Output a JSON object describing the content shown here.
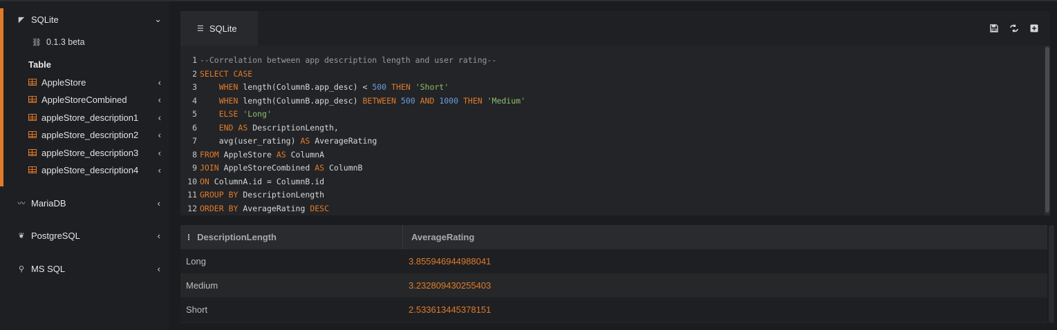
{
  "sidebar": {
    "sqlite": {
      "label": "SQLite",
      "version": "0.1.3 beta",
      "section": "Table",
      "tables": [
        "AppleStore",
        "AppleStoreCombined",
        "appleStore_description1",
        "appleStore_description2",
        "appleStore_description3",
        "appleStore_description4"
      ]
    },
    "others": [
      {
        "label": "MariaDB",
        "icon": "mariadb-icon"
      },
      {
        "label": "PostgreSQL",
        "icon": "postgresql-icon"
      },
      {
        "label": "MS SQL",
        "icon": "mssql-icon"
      }
    ]
  },
  "editor": {
    "tab_label": "SQLite",
    "toolbar": [
      "save-icon",
      "refresh-icon",
      "add-icon"
    ],
    "lines": [
      "--Correlation between app description length and user rating--",
      "SELECT CASE",
      "    WHEN length(ColumnB.app_desc) < 500 THEN 'Short'",
      "    WHEN length(ColumnB.app_desc) BETWEEN 500 AND 1000 THEN 'Medium'",
      "    ELSE 'Long'",
      "    END AS DescriptionLength,",
      "    avg(user_rating) AS AverageRating",
      "FROM AppleStore AS ColumnA",
      "JOIN AppleStoreCombined AS ColumnB",
      "ON ColumnA.id = ColumnB.id",
      "GROUP BY DescriptionLength",
      "ORDER BY AverageRating DESC"
    ]
  },
  "results": {
    "columns": [
      "DescriptionLength",
      "AverageRating"
    ],
    "rows": [
      [
        "Long",
        "3.855946944988041"
      ],
      [
        "Medium",
        "3.232809430255403"
      ],
      [
        "Short",
        "2.533613445378151"
      ]
    ]
  },
  "colors": {
    "accent": "#e07b2a",
    "keyword": "#e07b2a",
    "number": "#6c9ee0",
    "string": "#8fbf6a",
    "comment": "#9a9a9a"
  }
}
